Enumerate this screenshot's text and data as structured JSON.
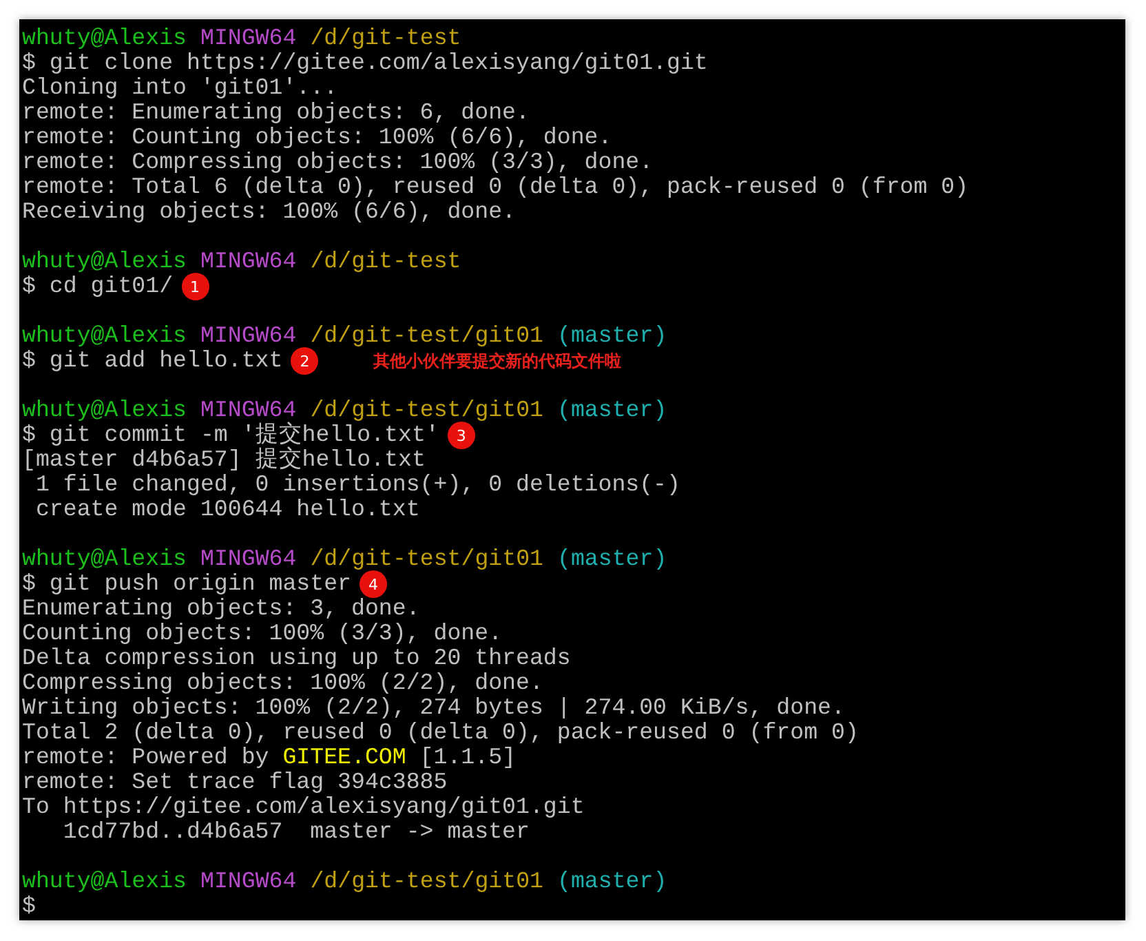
{
  "lines": [
    {
      "kind": "prompt",
      "user": "whuty@Alexis",
      "system": "MINGW64",
      "path": "/d/git-test"
    },
    {
      "kind": "command",
      "text": "$ git clone https://gitee.com/alexisyang/git01.git"
    },
    {
      "kind": "output",
      "parts": [
        {
          "text": "Cloning into 'git01'...",
          "highlight": false
        }
      ]
    },
    {
      "kind": "output",
      "parts": [
        {
          "text": "remote: Enumerating objects: 6, done.",
          "highlight": false
        }
      ]
    },
    {
      "kind": "output",
      "parts": [
        {
          "text": "remote: Counting objects: 100% (6/6), done.",
          "highlight": false
        }
      ]
    },
    {
      "kind": "output",
      "parts": [
        {
          "text": "remote: Compressing objects: 100% (3/3), done.",
          "highlight": false
        }
      ]
    },
    {
      "kind": "output",
      "parts": [
        {
          "text": "remote: Total 6 (delta 0), reused 0 (delta 0), pack-reused 0 (from 0)",
          "highlight": false
        }
      ]
    },
    {
      "kind": "output",
      "parts": [
        {
          "text": "Receiving objects: 100% (6/6), done.",
          "highlight": false
        }
      ]
    },
    {
      "kind": "blank"
    },
    {
      "kind": "prompt",
      "user": "whuty@Alexis",
      "system": "MINGW64",
      "path": "/d/git-test"
    },
    {
      "kind": "command",
      "text": "$ cd git01/",
      "badge": "1"
    },
    {
      "kind": "blank"
    },
    {
      "kind": "prompt",
      "user": "whuty@Alexis",
      "system": "MINGW64",
      "path": "/d/git-test/git01",
      "branch": "(master)"
    },
    {
      "kind": "command",
      "text": "$ git add hello.txt",
      "badge": "2",
      "note": "其他小伙伴要提交新的代码文件啦"
    },
    {
      "kind": "blank"
    },
    {
      "kind": "prompt",
      "user": "whuty@Alexis",
      "system": "MINGW64",
      "path": "/d/git-test/git01",
      "branch": "(master)"
    },
    {
      "kind": "command",
      "text": "$ git commit -m '提交hello.txt'",
      "badge": "3"
    },
    {
      "kind": "output",
      "parts": [
        {
          "text": "[master d4b6a57] 提交hello.txt",
          "highlight": false
        }
      ]
    },
    {
      "kind": "output",
      "parts": [
        {
          "text": " 1 file changed, 0 insertions(+), 0 deletions(-)",
          "highlight": false
        }
      ]
    },
    {
      "kind": "output",
      "parts": [
        {
          "text": " create mode 100644 hello.txt",
          "highlight": false
        }
      ]
    },
    {
      "kind": "blank"
    },
    {
      "kind": "prompt",
      "user": "whuty@Alexis",
      "system": "MINGW64",
      "path": "/d/git-test/git01",
      "branch": "(master)"
    },
    {
      "kind": "command",
      "text": "$ git push origin master",
      "badge": "4"
    },
    {
      "kind": "output",
      "parts": [
        {
          "text": "Enumerating objects: 3, done.",
          "highlight": false
        }
      ]
    },
    {
      "kind": "output",
      "parts": [
        {
          "text": "Counting objects: 100% (3/3), done.",
          "highlight": false
        }
      ]
    },
    {
      "kind": "output",
      "parts": [
        {
          "text": "Delta compression using up to 20 threads",
          "highlight": false
        }
      ]
    },
    {
      "kind": "output",
      "parts": [
        {
          "text": "Compressing objects: 100% (2/2), done.",
          "highlight": false
        }
      ]
    },
    {
      "kind": "output",
      "parts": [
        {
          "text": "Writing objects: 100% (2/2), 274 bytes | 274.00 KiB/s, done.",
          "highlight": false
        }
      ]
    },
    {
      "kind": "output",
      "parts": [
        {
          "text": "Total 2 (delta 0), reused 0 (delta 0), pack-reused 0 (from 0)",
          "highlight": false
        }
      ]
    },
    {
      "kind": "output",
      "parts": [
        {
          "text": "remote: Powered by ",
          "highlight": false
        },
        {
          "text": "GITEE.COM",
          "highlight": true
        },
        {
          "text": " [1.1.5]",
          "highlight": false
        }
      ]
    },
    {
      "kind": "output",
      "parts": [
        {
          "text": "remote: Set trace flag 394c3885",
          "highlight": false
        }
      ]
    },
    {
      "kind": "output",
      "parts": [
        {
          "text": "To https://gitee.com/alexisyang/git01.git",
          "highlight": false
        }
      ]
    },
    {
      "kind": "output",
      "parts": [
        {
          "text": "   1cd77bd..d4b6a57  master -> master",
          "highlight": false
        }
      ]
    },
    {
      "kind": "blank"
    },
    {
      "kind": "prompt",
      "user": "whuty@Alexis",
      "system": "MINGW64",
      "path": "/d/git-test/git01",
      "branch": "(master)"
    },
    {
      "kind": "command",
      "text": "$"
    }
  ]
}
